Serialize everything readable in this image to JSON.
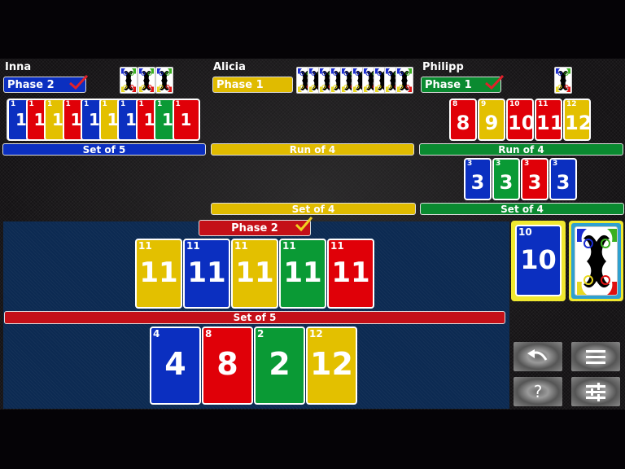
{
  "colors": {
    "blue": "#0b2fc0",
    "red": "#e00008",
    "yellow": "#e3c000",
    "green": "#0a9a35",
    "table_blue": "#0c2a52"
  },
  "opponents": [
    {
      "name": "Inna",
      "phase": "Phase 2",
      "phase_color": "blue",
      "phase_complete": true,
      "hand_count": 3,
      "melds": [
        {
          "label": "Set of 5",
          "cards": [
            {
              "value": "1",
              "color": "blue"
            },
            {
              "value": "1",
              "color": "red"
            },
            {
              "value": "1",
              "color": "yellow"
            },
            {
              "value": "1",
              "color": "red"
            },
            {
              "value": "1",
              "color": "blue"
            },
            {
              "value": "1",
              "color": "yellow"
            },
            {
              "value": "1",
              "color": "blue"
            },
            {
              "value": "1",
              "color": "red"
            },
            {
              "value": "1",
              "color": "green"
            },
            {
              "value": "1",
              "color": "red"
            }
          ]
        }
      ]
    },
    {
      "name": "Alicia",
      "phase": "Phase 1",
      "phase_color": "yellow",
      "phase_complete": false,
      "hand_count": 10,
      "melds": [
        {
          "label": "Run of 4",
          "cards": []
        },
        {
          "label": "Set of 4",
          "cards": []
        }
      ]
    },
    {
      "name": "Philipp",
      "phase": "Phase 1",
      "phase_color": "green",
      "phase_complete": true,
      "hand_count": 1,
      "melds": [
        {
          "label": "Run of 4",
          "cards": [
            {
              "value": "8",
              "color": "red"
            },
            {
              "value": "9",
              "color": "yellow"
            },
            {
              "value": "10",
              "color": "red"
            },
            {
              "value": "11",
              "color": "red"
            },
            {
              "value": "12",
              "color": "yellow"
            }
          ]
        },
        {
          "label": "Set of 4",
          "cards": [
            {
              "value": "3",
              "color": "blue"
            },
            {
              "value": "3",
              "color": "green"
            },
            {
              "value": "3",
              "color": "red"
            },
            {
              "value": "3",
              "color": "blue"
            }
          ]
        }
      ]
    }
  ],
  "player": {
    "phase": "Phase 2",
    "phase_complete": true,
    "meld": {
      "label": "Set of 5",
      "cards": [
        {
          "value": "11",
          "color": "yellow"
        },
        {
          "value": "11",
          "color": "blue"
        },
        {
          "value": "11",
          "color": "yellow"
        },
        {
          "value": "11",
          "color": "green"
        },
        {
          "value": "11",
          "color": "red"
        }
      ]
    },
    "hand": [
      {
        "value": "4",
        "color": "blue"
      },
      {
        "value": "8",
        "color": "red"
      },
      {
        "value": "2",
        "color": "green"
      },
      {
        "value": "12",
        "color": "yellow"
      }
    ]
  },
  "discard_pile": {
    "value": "10",
    "color": "blue"
  },
  "draw_pile": {
    "label": "face-down deck"
  },
  "controls": {
    "undo": "undo-icon",
    "menu": "menu-icon",
    "help": "?",
    "settings": "settings-sliders-icon"
  }
}
